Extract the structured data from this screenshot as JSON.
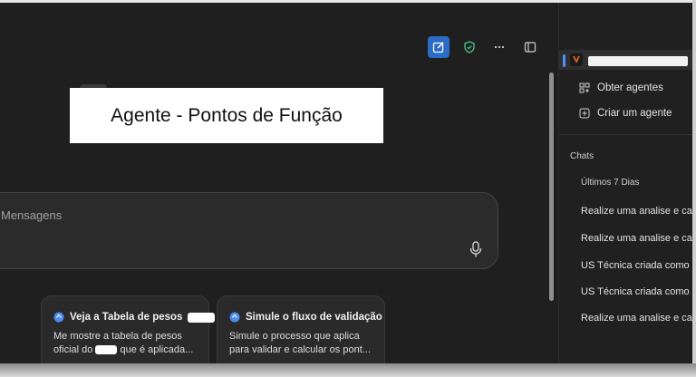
{
  "main": {
    "banner_title": "Agente - Pontos de Função",
    "composer_placeholder": "Mensagens",
    "cards": [
      {
        "title": "Veja a Tabela de pesos",
        "body_line1": "Me mostre a tabela de pesos",
        "body_line2_a": "oficial do",
        "body_line2_b": "que é aplicada..."
      },
      {
        "title": "Simule o fluxo de validação",
        "body_line1": "Simule o processo que aplica",
        "body_line2": "para validar e calcular os pont..."
      }
    ]
  },
  "sidebar": {
    "items": [
      {
        "label": "Obter agentes",
        "icon": "grid-add-icon"
      },
      {
        "label": "Criar um agente",
        "icon": "plus-square-icon"
      }
    ],
    "section_heading": "Chats",
    "period_label": "Últimos 7 Dias",
    "chats": [
      "Realize uma analise e calcu",
      "Realize uma analise e calcu",
      "US Técnica criada como que",
      "US Técnica criada como que",
      "Realize uma analise e calcu"
    ]
  },
  "colors": {
    "background": "#1f1f1f",
    "accent": "#2b6cc4",
    "sidebar": "#202020"
  }
}
